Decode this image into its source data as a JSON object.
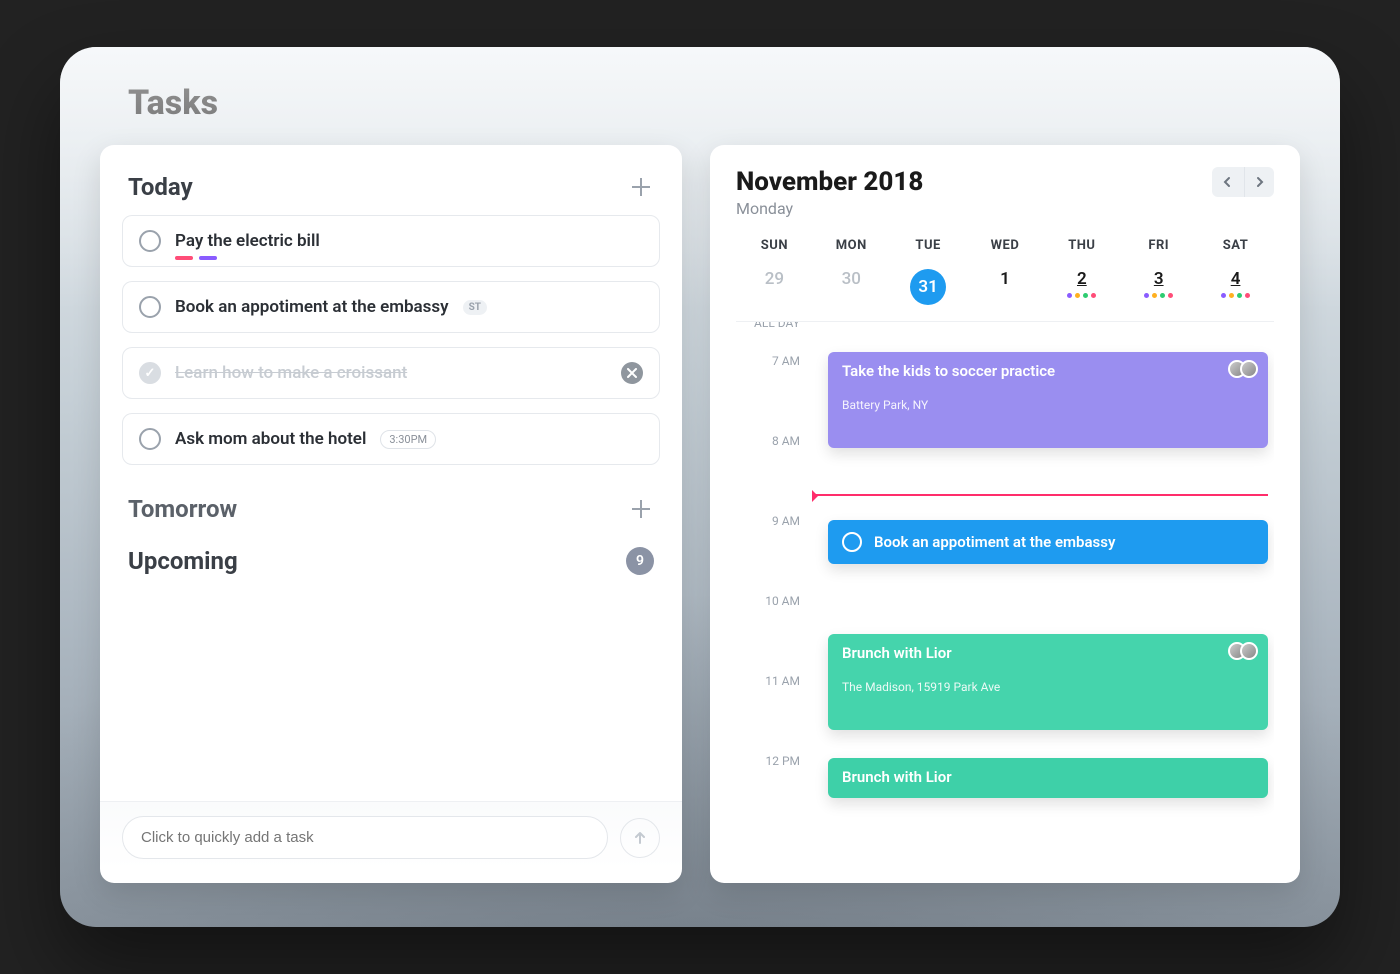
{
  "page_title": "Tasks",
  "tasks": {
    "sections": {
      "today": {
        "title": "Today"
      },
      "tomorrow": {
        "title": "Tomorrow"
      },
      "upcoming": {
        "title": "Upcoming",
        "count": "9"
      }
    },
    "today_items": [
      {
        "text": "Pay the electric bill",
        "completed": false,
        "tags": [
          "#ff4d78",
          "#8a5cff"
        ]
      },
      {
        "text": "Book an appotiment at the embassy",
        "completed": false,
        "badge": "ST"
      },
      {
        "text": "Learn how to make a croissant",
        "completed": true
      },
      {
        "text": "Ask mom about the hotel",
        "completed": false,
        "time": "3:30PM"
      }
    ],
    "quick_add_placeholder": "Click to quickly add a task"
  },
  "calendar": {
    "title": "November 2018",
    "subtitle": "Monday",
    "dow": [
      "SUN",
      "MON",
      "TUE",
      "WED",
      "THU",
      "FRI",
      "SAT"
    ],
    "dates": [
      {
        "num": "29",
        "muted": true
      },
      {
        "num": "30",
        "muted": true
      },
      {
        "num": "31",
        "selected": true
      },
      {
        "num": "1"
      },
      {
        "num": "2",
        "dots": [
          "#8a5cff",
          "#ffb020",
          "#2ecc71",
          "#ff4d78"
        ]
      },
      {
        "num": "3",
        "dots": [
          "#8a5cff",
          "#ffb020",
          "#2ecc71",
          "#ff4d78"
        ]
      },
      {
        "num": "4",
        "dots": [
          "#8a5cff",
          "#ffb020",
          "#2ecc71",
          "#ff4d78"
        ]
      }
    ],
    "all_day_label": "ALL DAY",
    "hours": [
      "7 AM",
      "8 AM",
      "9 AM",
      "10 AM",
      "11 AM",
      "12 PM"
    ],
    "events": [
      {
        "title": "Take the kids to soccer practice",
        "location": "Battery Park, NY",
        "style": "purple",
        "avatars": 2
      },
      {
        "title": "Book an appotiment at the embassy",
        "style": "blue"
      },
      {
        "title": "Brunch with Lior",
        "location": "The Madison, 15919 Park Ave",
        "style": "teal",
        "avatars": 2
      },
      {
        "title": "Brunch with Lior",
        "style": "teal2"
      }
    ]
  }
}
